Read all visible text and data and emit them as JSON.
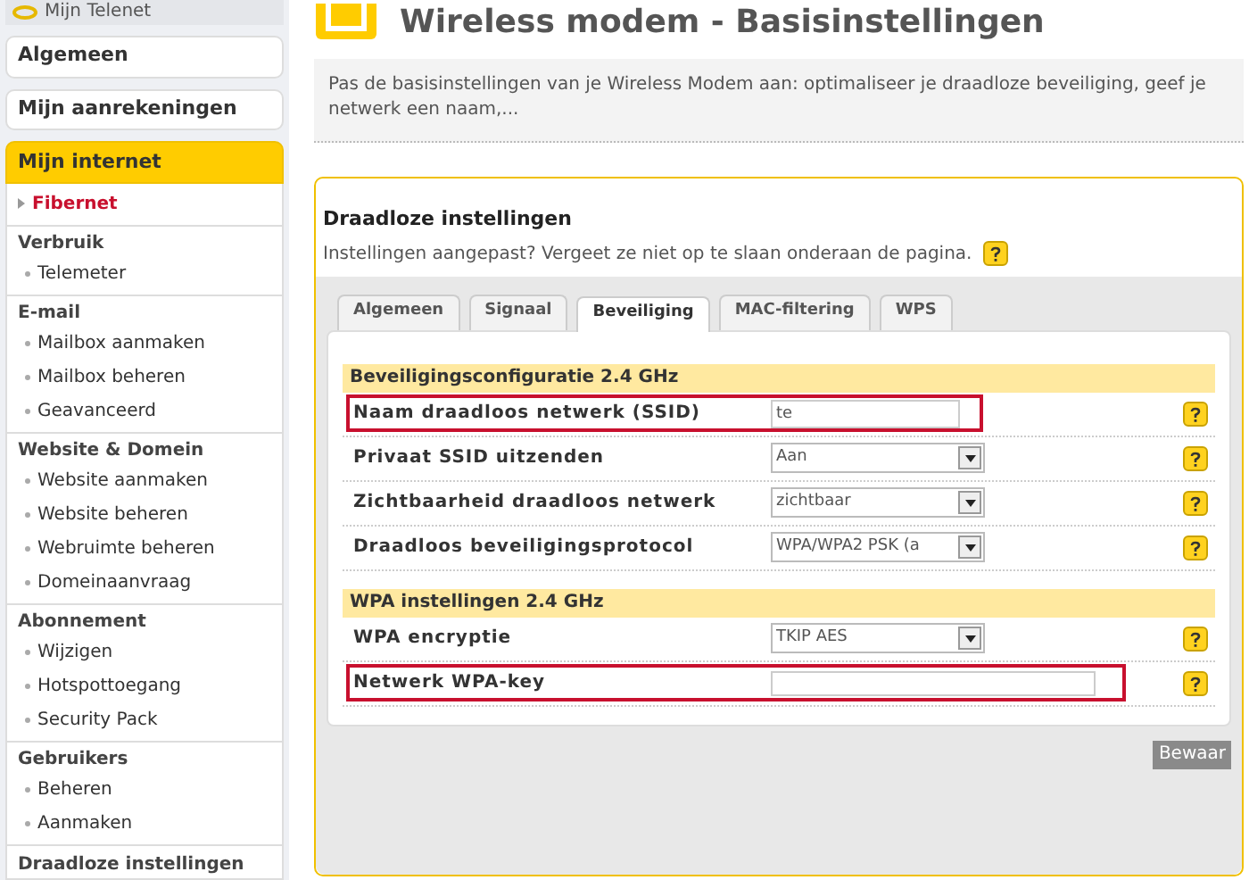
{
  "sidebar": {
    "top": {
      "label": "Mijn Telenet"
    },
    "menus": [
      {
        "label": "Algemeen",
        "selected": false
      },
      {
        "label": "Mijn aanrekeningen",
        "selected": false
      },
      {
        "label": "Mijn internet",
        "selected": true
      }
    ],
    "sections": [
      {
        "items": [
          {
            "label": "Fibernet",
            "selected": true
          }
        ]
      },
      {
        "heading": "Verbruik",
        "items": [
          {
            "label": "Telemeter",
            "selected": false
          }
        ]
      },
      {
        "heading": "E-mail",
        "items": [
          {
            "label": "Mailbox aanmaken",
            "selected": false
          },
          {
            "label": "Mailbox beheren",
            "selected": false
          },
          {
            "label": "Geavanceerd",
            "selected": false
          }
        ]
      },
      {
        "heading": "Website & Domein",
        "items": [
          {
            "label": "Website aanmaken",
            "selected": false
          },
          {
            "label": "Website beheren",
            "selected": false
          },
          {
            "label": "Webruimte beheren",
            "selected": false
          },
          {
            "label": "Domeinaanvraag",
            "selected": false
          }
        ]
      },
      {
        "heading": "Abonnement",
        "items": [
          {
            "label": "Wijzigen",
            "selected": false
          },
          {
            "label": "Hotspottoegang",
            "selected": false
          },
          {
            "label": "Security Pack",
            "selected": false
          }
        ]
      },
      {
        "heading": "Gebruikers",
        "items": [
          {
            "label": "Beheren",
            "selected": false
          },
          {
            "label": "Aanmaken",
            "selected": false
          }
        ]
      },
      {
        "heading": "Draadloze instellingen"
      }
    ]
  },
  "page": {
    "title": "Wireless modem - Basisinstellingen",
    "intro": "Pas de basisinstellingen van je Wireless Modem aan: optimaliseer je draadloze beveiliging, geef je netwerk een naam,..."
  },
  "card": {
    "title": "Draadloze instellingen",
    "note": "Instellingen aangepast? Vergeet ze niet op te slaan onderaan de pagina.",
    "tabs": [
      {
        "label": "Algemeen",
        "selected": false
      },
      {
        "label": "Signaal",
        "selected": false
      },
      {
        "label": "Beveiliging",
        "selected": true
      },
      {
        "label": "MAC-filtering",
        "selected": false
      },
      {
        "label": "WPS",
        "selected": false
      }
    ],
    "groups": [
      {
        "heading": "Beveiligingsconfiguratie 2.4 GHz",
        "rows": [
          {
            "kind": "text",
            "label": "Naam draadloos netwerk (SSID)",
            "value": "te",
            "highlighted": true
          },
          {
            "kind": "select",
            "label": "Privaat SSID uitzenden",
            "value": "Aan",
            "highlighted": false
          },
          {
            "kind": "select",
            "label": "Zichtbaarheid draadloos netwerk",
            "value": "zichtbaar",
            "highlighted": false
          },
          {
            "kind": "select",
            "label": "Draadloos beveiligingsprotocol",
            "value": "WPA/WPA2 PSK (a",
            "highlighted": false
          }
        ]
      },
      {
        "heading": "WPA instellingen 2.4 GHz",
        "rows": [
          {
            "kind": "select",
            "label": "WPA encryptie",
            "value": "TKIP AES",
            "highlighted": false
          },
          {
            "kind": "wide-text",
            "label": "Netwerk WPA-key",
            "highlighted": true
          }
        ]
      }
    ],
    "save_button": "Bewaar"
  }
}
